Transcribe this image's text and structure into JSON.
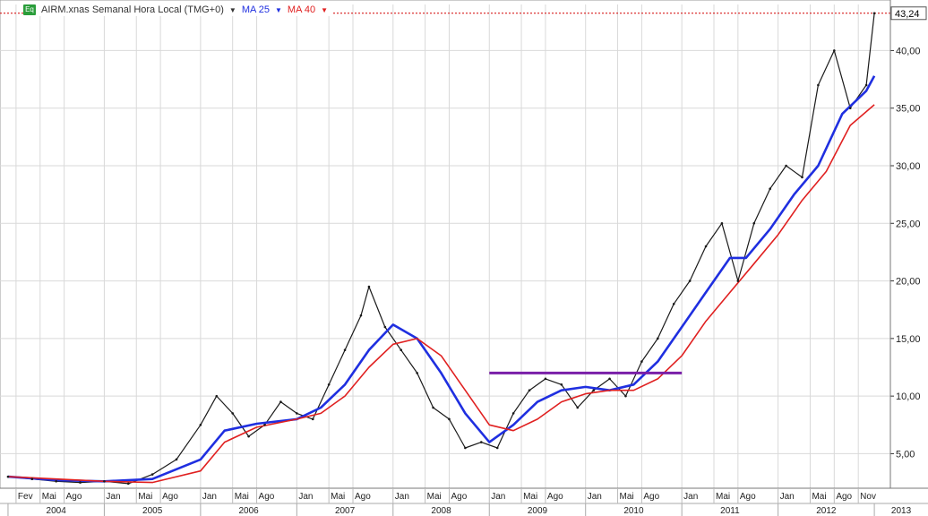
{
  "legend": {
    "badge": "Eq",
    "symbol_label": "AIRM.xnas Semanal Hora Local (TMG+0)",
    "ma25_label": "MA 25",
    "ma40_label": "MA 40",
    "dropdown_glyph": "▼"
  },
  "colors": {
    "price": "#1a1a1a",
    "ma25": "#1f2fe0",
    "ma40": "#e02020",
    "resistance": "#7a1fa8",
    "grid": "#d9d9d9",
    "last_price_line": "#d40000"
  },
  "chart_data": {
    "type": "line",
    "title": "AIRM.xnas Semanal Hora Local (TMG+0)",
    "xlabel": "",
    "ylabel": "",
    "ylim": [
      2.0,
      44.0
    ],
    "y_ticks": [
      "5,00",
      "10,00",
      "15,00",
      "20,00",
      "25,00",
      "30,00",
      "35,00",
      "40,00"
    ],
    "last_price": "43,24",
    "grid": true,
    "legend_position": "top-left",
    "x_month_labels": [
      "Fev",
      "Mai",
      "Ago",
      "Jan",
      "Mai",
      "Ago",
      "Jan",
      "Mai",
      "Ago",
      "Jan",
      "Mai",
      "Ago",
      "Jan",
      "Mai",
      "Ago",
      "Jan",
      "Mai",
      "Ago",
      "Jan",
      "Mai",
      "Ago",
      "Jan",
      "Mai",
      "Ago",
      "Jan",
      "Mai",
      "Ago",
      "Nov"
    ],
    "x_year_labels": [
      "2004",
      "2005",
      "2006",
      "2007",
      "2008",
      "2009",
      "2010",
      "2011",
      "2012",
      "2013"
    ],
    "resistance_level": 12.0,
    "resistance_range": [
      "2009-01",
      "2011-01"
    ],
    "series": [
      {
        "name": "AIRM.xnas",
        "points": [
          [
            "2004-01",
            3.0
          ],
          [
            "2004-04",
            2.8
          ],
          [
            "2004-07",
            2.6
          ],
          [
            "2004-10",
            2.5
          ],
          [
            "2005-01",
            2.6
          ],
          [
            "2005-04",
            2.4
          ],
          [
            "2005-07",
            3.2
          ],
          [
            "2005-10",
            4.5
          ],
          [
            "2006-01",
            7.5
          ],
          [
            "2006-03",
            10.0
          ],
          [
            "2006-05",
            8.5
          ],
          [
            "2006-07",
            6.5
          ],
          [
            "2006-09",
            7.5
          ],
          [
            "2006-11",
            9.5
          ],
          [
            "2007-01",
            8.5
          ],
          [
            "2007-03",
            8.0
          ],
          [
            "2007-05",
            11.0
          ],
          [
            "2007-07",
            14.0
          ],
          [
            "2007-09",
            17.0
          ],
          [
            "2007-10",
            19.5
          ],
          [
            "2007-12",
            16.0
          ],
          [
            "2008-02",
            14.0
          ],
          [
            "2008-04",
            12.0
          ],
          [
            "2008-06",
            9.0
          ],
          [
            "2008-08",
            8.0
          ],
          [
            "2008-10",
            5.5
          ],
          [
            "2008-12",
            6.0
          ],
          [
            "2009-02",
            5.5
          ],
          [
            "2009-04",
            8.5
          ],
          [
            "2009-06",
            10.5
          ],
          [
            "2009-08",
            11.5
          ],
          [
            "2009-10",
            11.0
          ],
          [
            "2009-12",
            9.0
          ],
          [
            "2010-02",
            10.5
          ],
          [
            "2010-04",
            11.5
          ],
          [
            "2010-06",
            10.0
          ],
          [
            "2010-08",
            13.0
          ],
          [
            "2010-10",
            15.0
          ],
          [
            "2010-12",
            18.0
          ],
          [
            "2011-02",
            20.0
          ],
          [
            "2011-04",
            23.0
          ],
          [
            "2011-06",
            25.0
          ],
          [
            "2011-08",
            20.0
          ],
          [
            "2011-10",
            25.0
          ],
          [
            "2011-12",
            28.0
          ],
          [
            "2012-02",
            30.0
          ],
          [
            "2012-04",
            29.0
          ],
          [
            "2012-06",
            37.0
          ],
          [
            "2012-08",
            40.0
          ],
          [
            "2012-10",
            35.0
          ],
          [
            "2012-12",
            37.0
          ],
          [
            "2013-01",
            43.24
          ]
        ]
      },
      {
        "name": "MA 25",
        "points": [
          [
            "2004-01",
            3.0
          ],
          [
            "2004-07",
            2.7
          ],
          [
            "2005-01",
            2.6
          ],
          [
            "2005-07",
            2.8
          ],
          [
            "2006-01",
            4.5
          ],
          [
            "2006-04",
            7.0
          ],
          [
            "2006-08",
            7.6
          ],
          [
            "2007-01",
            8.0
          ],
          [
            "2007-04",
            9.0
          ],
          [
            "2007-07",
            11.0
          ],
          [
            "2007-10",
            14.0
          ],
          [
            "2008-01",
            16.2
          ],
          [
            "2008-04",
            15.0
          ],
          [
            "2008-07",
            12.0
          ],
          [
            "2008-10",
            8.5
          ],
          [
            "2009-01",
            6.0
          ],
          [
            "2009-04",
            7.5
          ],
          [
            "2009-07",
            9.5
          ],
          [
            "2009-10",
            10.5
          ],
          [
            "2010-01",
            10.8
          ],
          [
            "2010-04",
            10.5
          ],
          [
            "2010-07",
            11.0
          ],
          [
            "2010-10",
            13.0
          ],
          [
            "2011-01",
            16.0
          ],
          [
            "2011-04",
            19.0
          ],
          [
            "2011-07",
            22.0
          ],
          [
            "2011-09",
            22.0
          ],
          [
            "2011-12",
            24.5
          ],
          [
            "2012-03",
            27.5
          ],
          [
            "2012-06",
            30.0
          ],
          [
            "2012-09",
            34.5
          ],
          [
            "2012-12",
            36.5
          ],
          [
            "2013-01",
            37.8
          ]
        ]
      },
      {
        "name": "MA 40",
        "points": [
          [
            "2004-01",
            3.0
          ],
          [
            "2004-07",
            2.8
          ],
          [
            "2005-01",
            2.6
          ],
          [
            "2005-07",
            2.5
          ],
          [
            "2006-01",
            3.5
          ],
          [
            "2006-04",
            6.0
          ],
          [
            "2006-08",
            7.3
          ],
          [
            "2007-01",
            8.0
          ],
          [
            "2007-04",
            8.5
          ],
          [
            "2007-07",
            10.0
          ],
          [
            "2007-10",
            12.5
          ],
          [
            "2008-01",
            14.5
          ],
          [
            "2008-04",
            15.0
          ],
          [
            "2008-07",
            13.5
          ],
          [
            "2008-10",
            10.5
          ],
          [
            "2009-01",
            7.5
          ],
          [
            "2009-04",
            7.0
          ],
          [
            "2009-07",
            8.0
          ],
          [
            "2009-10",
            9.5
          ],
          [
            "2010-01",
            10.2
          ],
          [
            "2010-04",
            10.5
          ],
          [
            "2010-07",
            10.5
          ],
          [
            "2010-10",
            11.5
          ],
          [
            "2011-01",
            13.5
          ],
          [
            "2011-04",
            16.5
          ],
          [
            "2011-07",
            19.0
          ],
          [
            "2011-10",
            21.5
          ],
          [
            "2012-01",
            24.0
          ],
          [
            "2012-04",
            27.0
          ],
          [
            "2012-07",
            29.5
          ],
          [
            "2012-10",
            33.5
          ],
          [
            "2013-01",
            35.3
          ]
        ]
      }
    ]
  }
}
